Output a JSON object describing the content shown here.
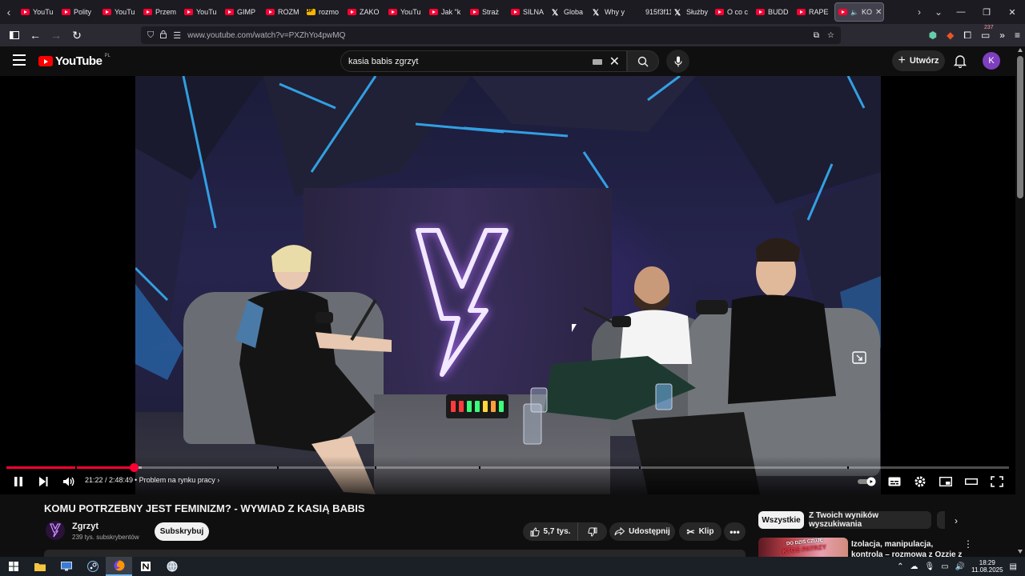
{
  "browser": {
    "tabs": [
      {
        "title": "YouTu",
        "icon": "youtube-icon"
      },
      {
        "title": "Polity",
        "icon": "youtube-icon"
      },
      {
        "title": "YouTu",
        "icon": "youtube-icon"
      },
      {
        "title": "Przem",
        "icon": "youtube-icon"
      },
      {
        "title": "YouTu",
        "icon": "youtube-icon"
      },
      {
        "title": "GIMP",
        "icon": "youtube-icon"
      },
      {
        "title": "ROZM",
        "icon": "youtube-icon"
      },
      {
        "title": "rozmo",
        "icon": "jp-icon"
      },
      {
        "title": "ZAKO",
        "icon": "youtube-icon"
      },
      {
        "title": "YouTu",
        "icon": "youtube-icon"
      },
      {
        "title": "Jak \"k",
        "icon": "youtube-icon"
      },
      {
        "title": "Straż",
        "icon": "youtube-icon"
      },
      {
        "title": "SILNA",
        "icon": "youtube-icon"
      },
      {
        "title": "Globa",
        "icon": "x-icon"
      },
      {
        "title": "Why y",
        "icon": "x-icon"
      },
      {
        "title": "915f3f112",
        "icon": "none"
      },
      {
        "title": "Służby",
        "icon": "x-icon"
      },
      {
        "title": "O co c",
        "icon": "youtube-icon"
      },
      {
        "title": "BUDD",
        "icon": "youtube-icon"
      },
      {
        "title": "RAPE",
        "icon": "youtube-icon"
      }
    ],
    "active_tab": {
      "title": "KO",
      "icon": "youtube-icon"
    },
    "url": "www.youtube.com/watch?v=PXZhYo4pwMQ",
    "extension_badge": "237"
  },
  "youtube": {
    "logo_text": "YouTube",
    "logo_region": "PL",
    "search_query": "kasia babis zgrzyt",
    "create_label": "Utwórz",
    "avatar_letter": "K"
  },
  "player": {
    "current_time": "21:22",
    "duration": "2:48:49",
    "time_display": "21:22 / 2:48:49",
    "chapter": "Problem na rynku pracy",
    "progress_fraction": 0.127,
    "buffer_fraction": 0.135
  },
  "video": {
    "title": "KOMU POTRZEBNY JEST FEMINIZM? - WYWIAD Z KASIĄ BABIS",
    "channel": "Zgrzyt",
    "subscribers": "239 tys. subskrybentów",
    "subscribe_label": "Subskrybuj",
    "likes": "5,7 tys.",
    "share_label": "Udostępnij",
    "clip_label": "Klip"
  },
  "sidebar": {
    "chips": [
      "Wszystkie",
      "Z Twoich wyników wyszukiwania"
    ],
    "recommendation": {
      "title": "Izolacja, manipulacja, kontrola – rozmowa z Ozzie z Gaba",
      "thumb_text_1": "DO DZIŚ CZUJĘ",
      "thumb_text_2": "KTOŚ PATRZY"
    }
  },
  "taskbar": {
    "time": "18:29",
    "date": "11.08.2025"
  },
  "colors": {
    "yt_red": "#ff0033",
    "bg": "#0f0f0f",
    "chip_bg": "#272727",
    "avatar": "#7e3fbf"
  }
}
